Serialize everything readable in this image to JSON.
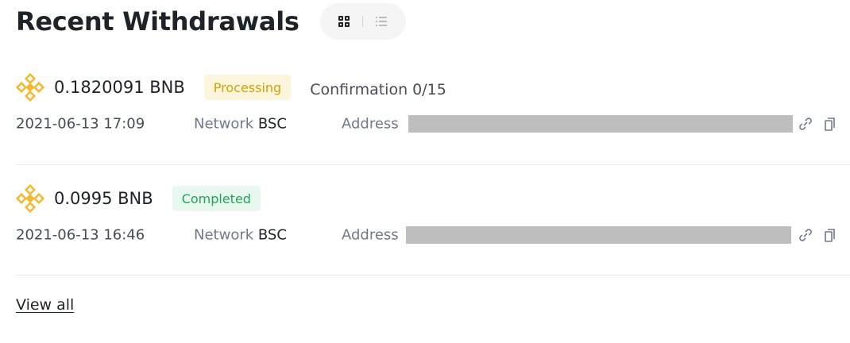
{
  "header": {
    "title": "Recent Withdrawals",
    "view_toggle": {
      "grid_icon": "grid-icon",
      "list_icon": "list-icon"
    }
  },
  "withdrawals": [
    {
      "coin_icon": "bnb-icon",
      "amount": "0.1820091 BNB",
      "status": "Processing",
      "status_color": "#d2a008",
      "confirmation": "Confirmation 0/15",
      "date": "2021-06-13 17:09",
      "network_label": "Network",
      "network": "BSC",
      "address_label": "Address",
      "address_redacted": true
    },
    {
      "coin_icon": "bnb-icon",
      "amount": "0.0995 BNB",
      "status": "Completed",
      "status_color": "#22a35d",
      "date": "2021-06-13 16:46",
      "network_label": "Network",
      "network": "BSC",
      "address_label": "Address",
      "address_redacted": true
    }
  ],
  "footer": {
    "view_all": "View all"
  },
  "colors": {
    "bnb_accent": "#f3ba2f",
    "text_primary": "#1e2329",
    "text_secondary": "#707a8a"
  }
}
